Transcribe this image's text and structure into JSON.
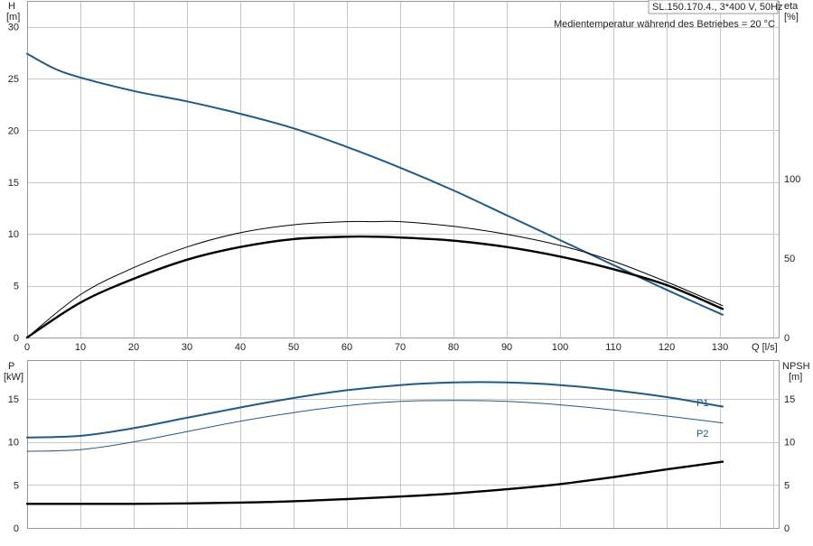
{
  "header": {
    "model": "SL.150.170.4., 3*400 V, 50Hz",
    "medium_note": "Medientemperatur während des Betriebes = 20 °C"
  },
  "colors": {
    "blue": "#1f5a8a",
    "black": "#000000",
    "grid": "#c8c8c8",
    "frame": "#9a9a9a"
  },
  "chart_data": [
    {
      "type": "line",
      "name": "upper",
      "x_label": "Q [l/s]",
      "left_axis": {
        "label_top": "H",
        "label_unit": "[m]",
        "range": [
          0,
          32.5
        ],
        "ticks": [
          0,
          5,
          10,
          15,
          20,
          25,
          30
        ]
      },
      "right_axis": {
        "label_top": "eta",
        "label_unit": "[%]",
        "range": [
          0,
          212
        ],
        "ticks": [
          0,
          50,
          100
        ]
      },
      "x_range": [
        0,
        141
      ],
      "x_ticks": [
        0,
        10,
        20,
        30,
        40,
        50,
        60,
        70,
        80,
        90,
        100,
        110,
        120,
        130
      ],
      "grid": true,
      "series": [
        {
          "axis": "left",
          "color": "#1f5a8a",
          "width": 2,
          "points": [
            [
              0,
              27.4
            ],
            [
              5,
              26.0
            ],
            [
              10,
              25.1
            ],
            [
              20,
              23.8
            ],
            [
              30,
              22.8
            ],
            [
              40,
              21.6
            ],
            [
              50,
              20.2
            ],
            [
              60,
              18.4
            ],
            [
              70,
              16.4
            ],
            [
              80,
              14.2
            ],
            [
              90,
              11.8
            ],
            [
              100,
              9.4
            ],
            [
              110,
              7.0
            ],
            [
              120,
              4.6
            ],
            [
              130.5,
              2.2
            ]
          ]
        },
        {
          "axis": "right",
          "color": "#000000",
          "width": 1,
          "points": [
            [
              0,
              0
            ],
            [
              10,
              27
            ],
            [
              20,
              44
            ],
            [
              30,
              57
            ],
            [
              40,
              66
            ],
            [
              50,
              71
            ],
            [
              60,
              73
            ],
            [
              65,
              73
            ],
            [
              70,
              73
            ],
            [
              80,
              70
            ],
            [
              90,
              65
            ],
            [
              100,
              58
            ],
            [
              110,
              48
            ],
            [
              120,
              35
            ],
            [
              130.5,
              20
            ]
          ]
        },
        {
          "axis": "right",
          "color": "#000000",
          "width": 2.4,
          "points": [
            [
              0,
              0
            ],
            [
              10,
              22
            ],
            [
              20,
              37
            ],
            [
              30,
              49
            ],
            [
              40,
              57
            ],
            [
              50,
              62
            ],
            [
              60,
              63.5
            ],
            [
              65,
              63.5
            ],
            [
              70,
              63
            ],
            [
              80,
              61
            ],
            [
              90,
              57
            ],
            [
              100,
              51
            ],
            [
              110,
              43
            ],
            [
              120,
              33
            ],
            [
              130.5,
              18
            ]
          ]
        }
      ]
    },
    {
      "type": "line",
      "name": "lower",
      "left_axis": {
        "label_top": "P",
        "label_unit": "[kW]",
        "range": [
          0,
          19.5
        ],
        "ticks": [
          0,
          5,
          10,
          15
        ]
      },
      "right_axis": {
        "label_top": "NPSH",
        "label_unit": "[m]",
        "range": [
          0,
          19.5
        ],
        "ticks": [
          0,
          5,
          10,
          15
        ]
      },
      "x_range": [
        0,
        141
      ],
      "grid": true,
      "series": [
        {
          "name": "P1",
          "axis": "left",
          "color": "#1f5a8a",
          "width": 2,
          "points": [
            [
              0,
              10.5
            ],
            [
              10,
              10.7
            ],
            [
              20,
              11.6
            ],
            [
              30,
              12.8
            ],
            [
              40,
              14.0
            ],
            [
              50,
              15.1
            ],
            [
              60,
              16.0
            ],
            [
              70,
              16.6
            ],
            [
              80,
              16.9
            ],
            [
              90,
              16.9
            ],
            [
              100,
              16.6
            ],
            [
              110,
              16.0
            ],
            [
              120,
              15.2
            ],
            [
              130.5,
              14.1
            ]
          ]
        },
        {
          "name": "P2",
          "axis": "left",
          "color": "#1f5a8a",
          "width": 1,
          "points": [
            [
              0,
              8.9
            ],
            [
              10,
              9.1
            ],
            [
              20,
              10.0
            ],
            [
              30,
              11.2
            ],
            [
              40,
              12.4
            ],
            [
              50,
              13.4
            ],
            [
              60,
              14.2
            ],
            [
              70,
              14.7
            ],
            [
              80,
              14.8
            ],
            [
              90,
              14.7
            ],
            [
              100,
              14.3
            ],
            [
              110,
              13.7
            ],
            [
              120,
              13.0
            ],
            [
              130.5,
              12.2
            ]
          ]
        },
        {
          "axis": "right",
          "color": "#000000",
          "width": 2.4,
          "points": [
            [
              0,
              2.8
            ],
            [
              10,
              2.8
            ],
            [
              20,
              2.8
            ],
            [
              30,
              2.85
            ],
            [
              40,
              2.95
            ],
            [
              50,
              3.1
            ],
            [
              60,
              3.35
            ],
            [
              70,
              3.65
            ],
            [
              80,
              4.0
            ],
            [
              90,
              4.5
            ],
            [
              100,
              5.1
            ],
            [
              110,
              5.9
            ],
            [
              120,
              6.8
            ],
            [
              130.5,
              7.7
            ]
          ]
        }
      ]
    }
  ]
}
